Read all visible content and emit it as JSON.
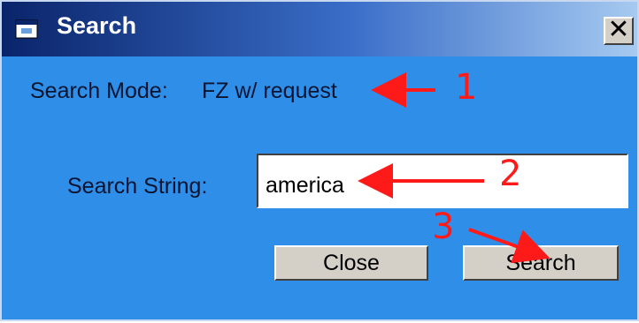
{
  "window": {
    "title": "Search",
    "close_glyph": "✕"
  },
  "mode": {
    "label": "Search Mode:",
    "value": "FZ w/ request"
  },
  "search": {
    "label": "Search String:",
    "value": "america"
  },
  "buttons": {
    "close": "Close",
    "search": "Search"
  },
  "annotations": {
    "step1": "1",
    "step2": "2",
    "step3": "3",
    "color": "#ff1a1a"
  },
  "icons": {
    "app": "search-window-icon",
    "close": "close-icon"
  }
}
